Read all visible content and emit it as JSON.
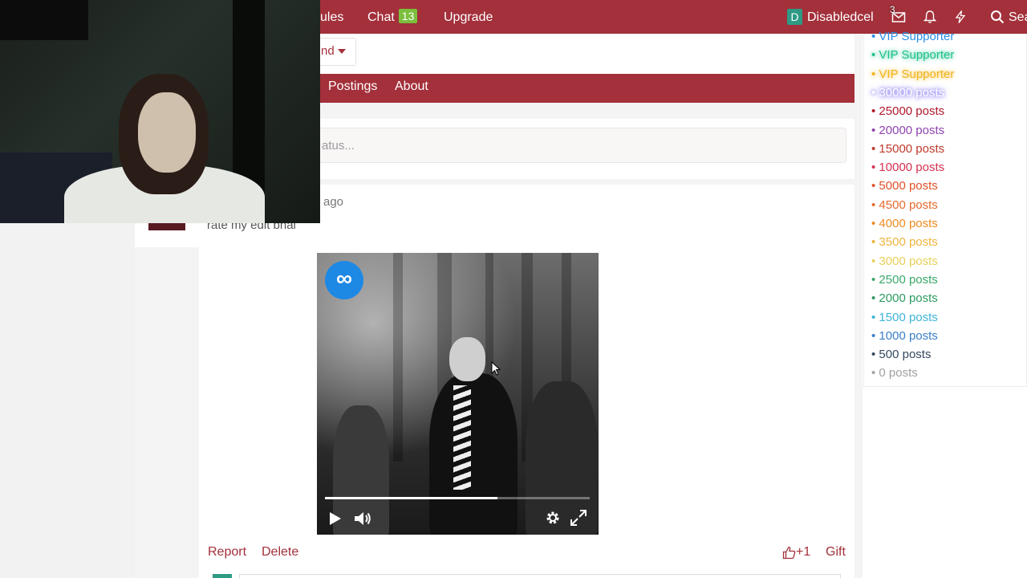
{
  "topbar": {
    "rules_label": "ules",
    "chat_label": "Chat",
    "chat_count": "13",
    "upgrade_label": "Upgrade",
    "user_initial": "D",
    "username": "Disabledcel",
    "message_count": "3",
    "search_label": "Sea"
  },
  "filter": {
    "dropdown_label": "nd"
  },
  "subnav": {
    "postings": "Postings",
    "about": "About"
  },
  "status": {
    "placeholder": "atus..."
  },
  "post": {
    "time": "ago",
    "text": "rate my edit bhai",
    "logo_glyph": "∞",
    "progress": 0.65,
    "report": "Report",
    "delete": "Delete",
    "like": "+1",
    "gift": "Gift"
  },
  "ranks": [
    {
      "label": "• VIP Supporter",
      "color": "#2b8fe6",
      "glow": false
    },
    {
      "label": "• VIP Supporter",
      "color": "#1fc28a",
      "glow": true
    },
    {
      "label": "• VIP Supporter",
      "color": "#f0b41e",
      "glow": true
    },
    {
      "label": "• 30000 posts",
      "color": "#ffffff",
      "glow": true
    },
    {
      "label": "• 25000 posts",
      "color": "#b0182a",
      "glow": false
    },
    {
      "label": "• 20000 posts",
      "color": "#8e44ad",
      "glow": false
    },
    {
      "label": "• 15000 posts",
      "color": "#c0392b",
      "glow": false
    },
    {
      "label": "• 10000 posts",
      "color": "#d63050",
      "glow": false
    },
    {
      "label": "• 5000 posts",
      "color": "#e0502a",
      "glow": false
    },
    {
      "label": "• 4500 posts",
      "color": "#e56a2c",
      "glow": false
    },
    {
      "label": "• 4000 posts",
      "color": "#ef8c22",
      "glow": false
    },
    {
      "label": "• 3500 posts",
      "color": "#f0b43c",
      "glow": false
    },
    {
      "label": "• 3000 posts",
      "color": "#e8d05a",
      "glow": false
    },
    {
      "label": "• 2500 posts",
      "color": "#3aa86a",
      "glow": false
    },
    {
      "label": "• 2000 posts",
      "color": "#2c9a60",
      "glow": false
    },
    {
      "label": "• 1500 posts",
      "color": "#3eb4d8",
      "glow": false
    },
    {
      "label": "• 1000 posts",
      "color": "#3a80c8",
      "glow": false
    },
    {
      "label": "• 500 posts",
      "color": "#34495e",
      "glow": false
    },
    {
      "label": "• 0 posts",
      "color": "#a0a0a0",
      "glow": false
    }
  ],
  "colors": {
    "brand": "#a3303a",
    "badge": "#7bbf3c"
  }
}
